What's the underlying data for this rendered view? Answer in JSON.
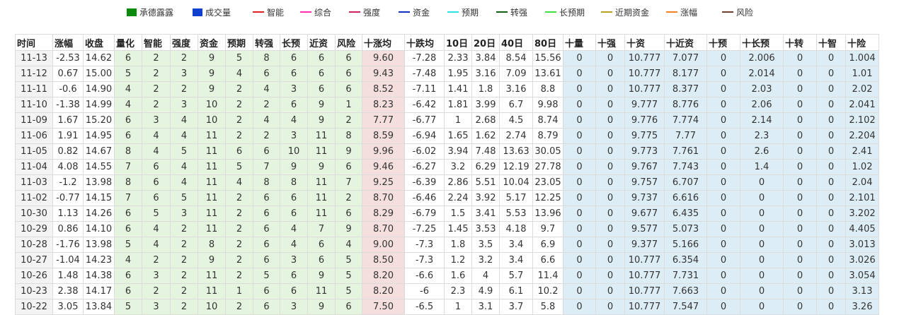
{
  "legend": [
    {
      "label": "承德露露",
      "color": "#0a8a0a",
      "shape": "box"
    },
    {
      "label": "成交量",
      "color": "#1040d0",
      "shape": "box"
    },
    {
      "label": "智能",
      "color": "#e02020",
      "shape": "line"
    },
    {
      "label": "综合",
      "color": "#ff30b0",
      "shape": "line"
    },
    {
      "label": "强度",
      "color": "#cc2060",
      "shape": "line"
    },
    {
      "label": "资金",
      "color": "#1030c0",
      "shape": "line"
    },
    {
      "label": "预期",
      "color": "#30e0e8",
      "shape": "line"
    },
    {
      "label": "转强",
      "color": "#106010",
      "shape": "line"
    },
    {
      "label": "长预期",
      "color": "#40e040",
      "shape": "line"
    },
    {
      "label": "近期资金",
      "color": "#b8a020",
      "shape": "line"
    },
    {
      "label": "涨幅",
      "color": "#f08020",
      "shape": "line"
    },
    {
      "label": "风险",
      "color": "#704030",
      "shape": "line"
    }
  ],
  "colors": {
    "up": "#e02020",
    "down": "#18a818",
    "green_bg": "#e4f4de",
    "pink_bg": "#f4dede",
    "blue_bg": "#ddedf6",
    "date_bg": "#f3f3f3"
  },
  "table": {
    "headers": [
      "时间",
      "涨幅",
      "收盘",
      "量化",
      "智能",
      "强度",
      "资金",
      "预期",
      "转强",
      "长预",
      "近资",
      "风险",
      "十涨均",
      "十跌均",
      "10日",
      "20日",
      "40日",
      "80日",
      "十量",
      "十强",
      "十资",
      "十近资",
      "十预",
      "十长预",
      "十转",
      "十智",
      "十险"
    ],
    "rows": [
      [
        "11-13",
        "-2.53",
        "14.62",
        "6",
        "2",
        "2",
        "9",
        "5",
        "8",
        "6",
        "6",
        "6",
        "9.60",
        "-7.28",
        "2.33",
        "3.84",
        "8.54",
        "15.56",
        "0",
        "0",
        "10.777",
        "7.077",
        "0",
        "2.006",
        "0",
        "0",
        "1.004"
      ],
      [
        "11-12",
        "0.67",
        "15.00",
        "5",
        "2",
        "3",
        "9",
        "4",
        "6",
        "6",
        "6",
        "6",
        "9.43",
        "-7.48",
        "1.95",
        "3.16",
        "7.09",
        "13.61",
        "0",
        "0",
        "10.777",
        "8.177",
        "0",
        "2.014",
        "0",
        "0",
        "1.01"
      ],
      [
        "11-11",
        "-0.6",
        "14.90",
        "4",
        "2",
        "2",
        "9",
        "2",
        "4",
        "3",
        "6",
        "6",
        "8.52",
        "-7.11",
        "1.41",
        "1.8",
        "3.16",
        "8.8",
        "0",
        "0",
        "10.777",
        "8.377",
        "0",
        "2.03",
        "0",
        "0",
        "2.02"
      ],
      [
        "11-10",
        "-1.38",
        "14.99",
        "4",
        "2",
        "3",
        "10",
        "2",
        "2",
        "6",
        "9",
        "1",
        "8.23",
        "-6.42",
        "1.81",
        "3.99",
        "6.7",
        "9.98",
        "0",
        "0",
        "9.777",
        "8.776",
        "0",
        "2.06",
        "0",
        "0",
        "2.041"
      ],
      [
        "11-09",
        "1.67",
        "15.20",
        "6",
        "3",
        "4",
        "10",
        "2",
        "4",
        "4",
        "9",
        "2",
        "7.77",
        "-6.77",
        "1",
        "2.68",
        "4.5",
        "8.74",
        "0",
        "0",
        "9.776",
        "7.774",
        "0",
        "2.14",
        "0",
        "0",
        "2.102"
      ],
      [
        "11-06",
        "1.91",
        "14.95",
        "6",
        "4",
        "4",
        "11",
        "2",
        "2",
        "3",
        "11",
        "8",
        "8.59",
        "-6.94",
        "1.65",
        "1.62",
        "2.74",
        "8.79",
        "0",
        "0",
        "9.775",
        "7.77",
        "0",
        "2.3",
        "0",
        "0",
        "2.204"
      ],
      [
        "11-05",
        "0.82",
        "14.67",
        "8",
        "4",
        "5",
        "11",
        "6",
        "6",
        "10",
        "11",
        "9",
        "9.96",
        "-6.02",
        "3.94",
        "7.48",
        "13.63",
        "30.05",
        "0",
        "0",
        "9.773",
        "7.761",
        "0",
        "2.6",
        "0",
        "0",
        "2.41"
      ],
      [
        "11-04",
        "4.08",
        "14.55",
        "7",
        "6",
        "4",
        "11",
        "5",
        "7",
        "9",
        "9",
        "6",
        "9.46",
        "-6.27",
        "3.2",
        "6.29",
        "12.19",
        "27.78",
        "0",
        "0",
        "9.767",
        "7.743",
        "0",
        "1.4",
        "0",
        "0",
        "1.02"
      ],
      [
        "11-03",
        "-1.2",
        "13.98",
        "8",
        "6",
        "4",
        "11",
        "4",
        "8",
        "8",
        "11",
        "7",
        "9.25",
        "-6.39",
        "2.86",
        "5.51",
        "10.04",
        "23.05",
        "0",
        "0",
        "9.757",
        "6.707",
        "0",
        "0",
        "0",
        "0",
        "2.04"
      ],
      [
        "11-02",
        "-0.77",
        "14.15",
        "7",
        "6",
        "5",
        "11",
        "2",
        "6",
        "6",
        "11",
        "2",
        "8.70",
        "-6.46",
        "2.24",
        "3.92",
        "5.17",
        "12.25",
        "0",
        "0",
        "9.737",
        "6.616",
        "0",
        "0",
        "0",
        "0",
        "2.101"
      ],
      [
        "10-30",
        "1.13",
        "14.26",
        "6",
        "5",
        "3",
        "11",
        "2",
        "6",
        "6",
        "11",
        "6",
        "8.29",
        "-6.79",
        "1.5",
        "3.41",
        "5.53",
        "13.96",
        "0",
        "0",
        "9.677",
        "6.435",
        "0",
        "0",
        "0",
        "0",
        "3.202"
      ],
      [
        "10-29",
        "0.86",
        "14.10",
        "6",
        "4",
        "2",
        "11",
        "2",
        "6",
        "4",
        "7",
        "9",
        "8.70",
        "-7.25",
        "1.45",
        "3.53",
        "4.18",
        "9.7",
        "0",
        "0",
        "9.577",
        "5.073",
        "0",
        "0",
        "0",
        "0",
        "4.405"
      ],
      [
        "10-28",
        "-1.76",
        "13.98",
        "5",
        "4",
        "2",
        "8",
        "2",
        "6",
        "4",
        "6",
        "4",
        "9.00",
        "-7.3",
        "1.8",
        "3.5",
        "3.4",
        "6.9",
        "0",
        "0",
        "9.377",
        "5.166",
        "0",
        "0",
        "0",
        "0",
        "3.013"
      ],
      [
        "10-27",
        "-1.04",
        "14.23",
        "4",
        "2",
        "2",
        "9",
        "2",
        "6",
        "3",
        "6",
        "5",
        "8.50",
        "-7.3",
        "1.2",
        "3.2",
        "3.4",
        "6.6",
        "0",
        "0",
        "10.777",
        "6.354",
        "0",
        "0",
        "0",
        "0",
        "3.026"
      ],
      [
        "10-26",
        "1.48",
        "14.38",
        "6",
        "3",
        "2",
        "11",
        "2",
        "5",
        "6",
        "9",
        "5",
        "8.20",
        "-6.6",
        "1.6",
        "4",
        "5.7",
        "11.4",
        "0",
        "0",
        "10.777",
        "7.731",
        "0",
        "0",
        "0",
        "0",
        "3.054"
      ],
      [
        "10-23",
        "2.38",
        "14.17",
        "6",
        "2",
        "2",
        "11",
        "1",
        "6",
        "6",
        "11",
        "5",
        "8.20",
        "-6",
        "2.3",
        "4.9",
        "6.1",
        "10.2",
        "0",
        "0",
        "10.777",
        "7.663",
        "0",
        "0",
        "0",
        "0",
        "3.13"
      ],
      [
        "10-22",
        "3.05",
        "13.84",
        "5",
        "3",
        "2",
        "10",
        "2",
        "6",
        "3",
        "9",
        "6",
        "7.50",
        "-6.5",
        "1",
        "3.1",
        "3.7",
        "5.8",
        "0",
        "0",
        "10.777",
        "7.547",
        "0",
        "0",
        "0",
        "0",
        "3.26"
      ]
    ]
  }
}
